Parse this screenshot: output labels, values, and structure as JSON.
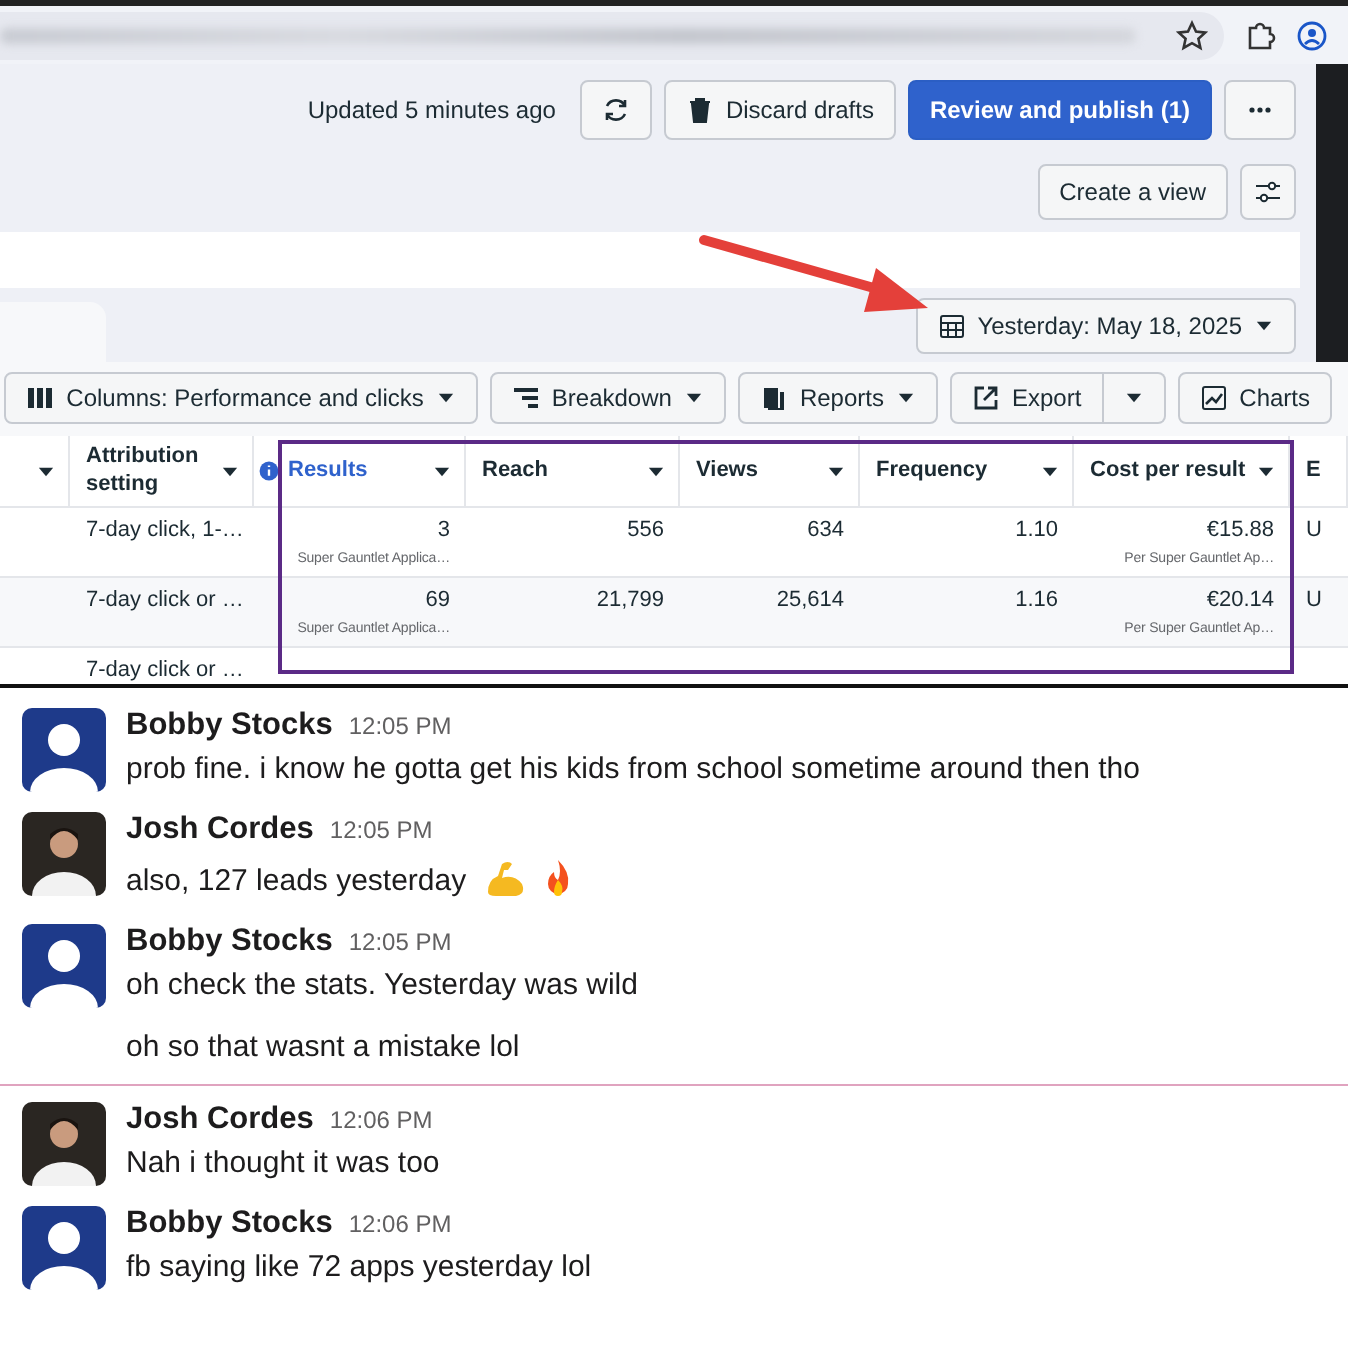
{
  "ads_manager": {
    "updated": "Updated 5 minutes ago",
    "discard_label": "Discard drafts",
    "publish_label": "Review and publish (1)",
    "create_view_label": "Create a view",
    "date_range": "Yesterday: May 18, 2025",
    "toolbar": [
      {
        "kind": "columns",
        "label": "Columns: Performance and clicks"
      },
      {
        "kind": "breakdown",
        "label": "Breakdown"
      },
      {
        "kind": "reports",
        "label": "Reports"
      },
      {
        "kind": "export",
        "label": "Export"
      },
      {
        "kind": "charts",
        "label": "Charts"
      }
    ],
    "table": {
      "columns": [
        {
          "label": "Attribution setting"
        },
        {
          "label": "Results",
          "info": true,
          "highlighted": true
        },
        {
          "label": "Reach"
        },
        {
          "label": "Views"
        },
        {
          "label": "Frequency"
        },
        {
          "label": "Cost per result"
        },
        {
          "label": "E"
        }
      ],
      "rows": [
        {
          "cells": [
            {
              "text": "7-day click, 1-…"
            },
            {
              "text": "3",
              "note": "Super Gauntlet Applica…"
            },
            {
              "text": "556"
            },
            {
              "text": "634"
            },
            {
              "text": "1.10"
            },
            {
              "text": "€15.88",
              "note": "Per Super Gauntlet Ap…"
            },
            {
              "text": "U"
            }
          ]
        },
        {
          "cells": [
            {
              "text": "7-day click or …"
            },
            {
              "text": "69",
              "note": "Super Gauntlet Applica…"
            },
            {
              "text": "21,799"
            },
            {
              "text": "25,614"
            },
            {
              "text": "1.16"
            },
            {
              "text": "€20.14",
              "note": "Per Super Gauntlet Ap…"
            },
            {
              "text": "U"
            }
          ]
        },
        {
          "cells": [
            {
              "text": "7-day click or …"
            }
          ]
        }
      ]
    }
  },
  "chat": {
    "messages": [
      {
        "kind": "default",
        "author": "Bobby Stocks",
        "time": "12:05 PM",
        "lines": [
          {
            "text": "prob fine. i know he gotta get his kids from school sometime around then tho"
          }
        ]
      },
      {
        "kind": "photo",
        "author": "Josh Cordes",
        "time": "12:05 PM",
        "lines": [
          {
            "text": "also, 127 leads yesterday",
            "icons": [
              {
                "kind": "biceps"
              },
              {
                "kind": "fire"
              }
            ]
          }
        ]
      },
      {
        "kind": "default",
        "author": "Bobby Stocks",
        "time": "12:05 PM",
        "lines": [
          {
            "text": "oh check the stats. Yesterday was wild"
          },
          {
            "text": "oh so that wasnt a mistake lol"
          }
        ],
        "divider_after": true
      },
      {
        "kind": "photo",
        "author": "Josh Cordes",
        "time": "12:06 PM",
        "lines": [
          {
            "text": "Nah i thought it was too"
          }
        ]
      },
      {
        "kind": "default",
        "author": "Bobby Stocks",
        "time": "12:06 PM",
        "lines": [
          {
            "text": "fb saying like 72 apps yesterday lol"
          }
        ]
      }
    ]
  }
}
